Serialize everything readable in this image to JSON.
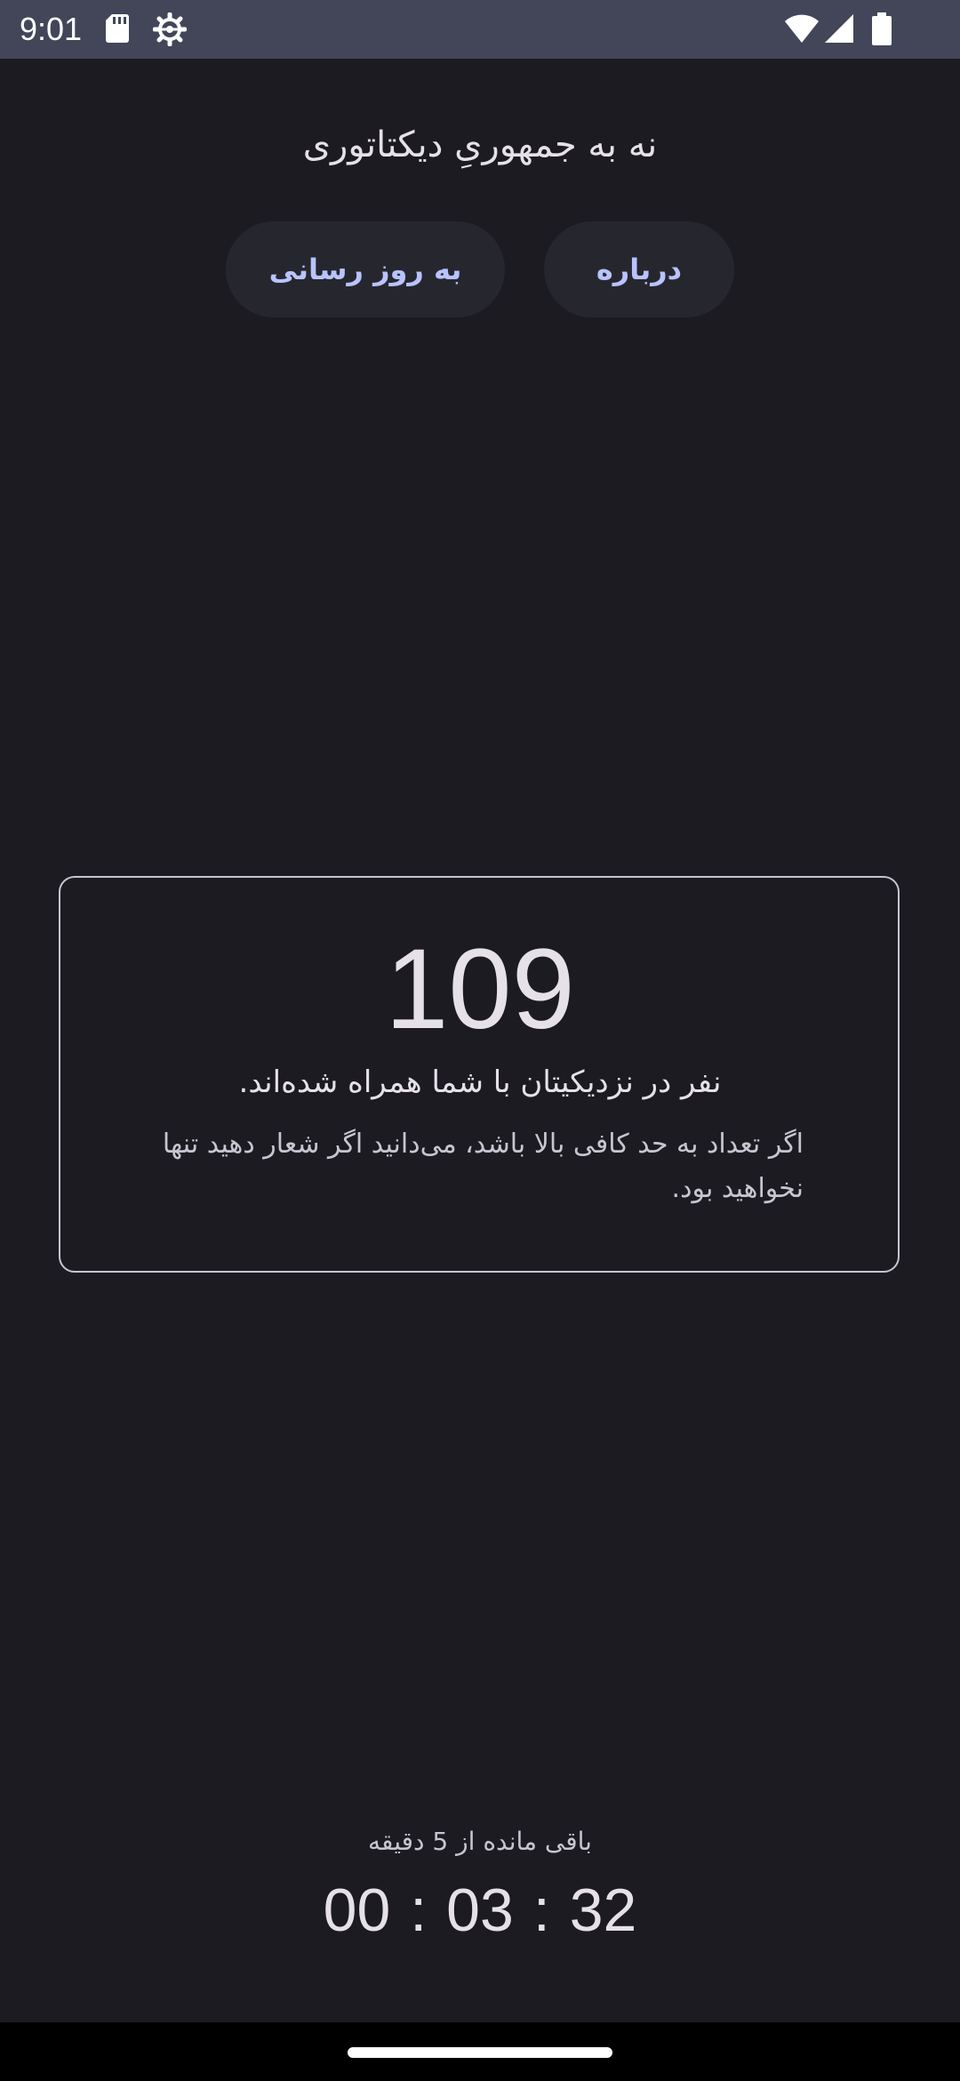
{
  "status_bar": {
    "time": "9:01",
    "left_icons": [
      "sd-card-icon",
      "settings-gear-icon"
    ],
    "right_icons": [
      "wifi-icon",
      "cell-signal-icon",
      "battery-icon"
    ]
  },
  "app": {
    "title": "نه به جمهوریِ دیکتاتوری"
  },
  "actions": {
    "about_label": "درباره",
    "update_label": "به روز رسانی"
  },
  "counter": {
    "value": "109",
    "label": "نفر در نزدیکیتان با شما همراه شده‌اند.",
    "note": "اگر تعداد به حد کافی بالا باشد، می‌دانید اگر شعار دهید تنها نخواهید بود."
  },
  "countdown": {
    "label": "باقی مانده از 5 دقیقه",
    "hours": "00",
    "minutes": "03",
    "seconds": "32",
    "separator": ":"
  },
  "colors": {
    "background": "#1c1b21",
    "status_bar": "#424658",
    "button_bg": "#26272e",
    "button_text": "#b9c3ff",
    "card_border": "#c4c6d2"
  }
}
